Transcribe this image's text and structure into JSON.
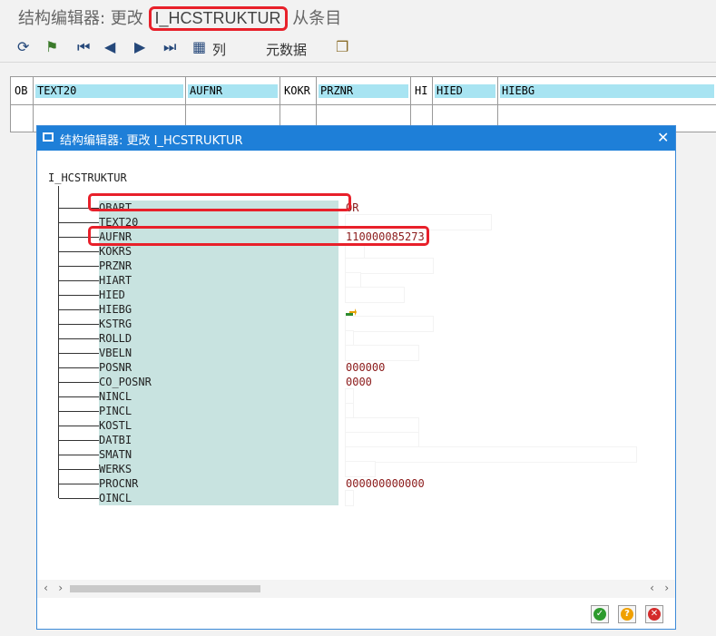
{
  "window": {
    "title_prefix": "结构编辑器: 更改",
    "title_highlight": "I_HCSTRUKTUR",
    "title_suffix": "从条目"
  },
  "toolbar": {
    "icons": [
      "refresh-icon",
      "hierarchy-icon",
      "first-icon",
      "prev-icon",
      "next-icon",
      "last-icon",
      "columns-icon",
      "copy-icon"
    ],
    "columns_label": "列",
    "metadata_label": "元数据"
  },
  "grid": {
    "columns": [
      "OB",
      "TEXT20",
      "AUFNR",
      "KOKR",
      "PRZNR",
      "HI",
      "HIED",
      "HIEBG"
    ]
  },
  "dialog": {
    "title": "结构编辑器: 更改 I_HCSTRUKTUR",
    "root": "I_HCSTRUKTUR",
    "fields": [
      {
        "name": "OBART",
        "value": "OR"
      },
      {
        "name": "TEXT20",
        "value": ""
      },
      {
        "name": "AUFNR",
        "value": "110000085273"
      },
      {
        "name": "KOKRS",
        "value": ""
      },
      {
        "name": "PRZNR",
        "value": ""
      },
      {
        "name": "HIART",
        "value": ""
      },
      {
        "name": "HIED",
        "value": ""
      },
      {
        "name": "HIEBG",
        "value": ""
      },
      {
        "name": "KSTRG",
        "value": ""
      },
      {
        "name": "ROLLD",
        "value": ""
      },
      {
        "name": "VBELN",
        "value": ""
      },
      {
        "name": "POSNR",
        "value": "000000"
      },
      {
        "name": "CO_POSNR",
        "value": "0000"
      },
      {
        "name": "NINCL",
        "value": ""
      },
      {
        "name": "PINCL",
        "value": ""
      },
      {
        "name": "KOSTL",
        "value": ""
      },
      {
        "name": "DATBI",
        "value": ""
      },
      {
        "name": "SMATN",
        "value": ""
      },
      {
        "name": "WERKS",
        "value": ""
      },
      {
        "name": "PROCNR",
        "value": "000000000000"
      },
      {
        "name": "OINCL",
        "value": ""
      }
    ]
  },
  "buttons": {
    "confirm": "✓",
    "help": "?",
    "cancel": "✕"
  }
}
